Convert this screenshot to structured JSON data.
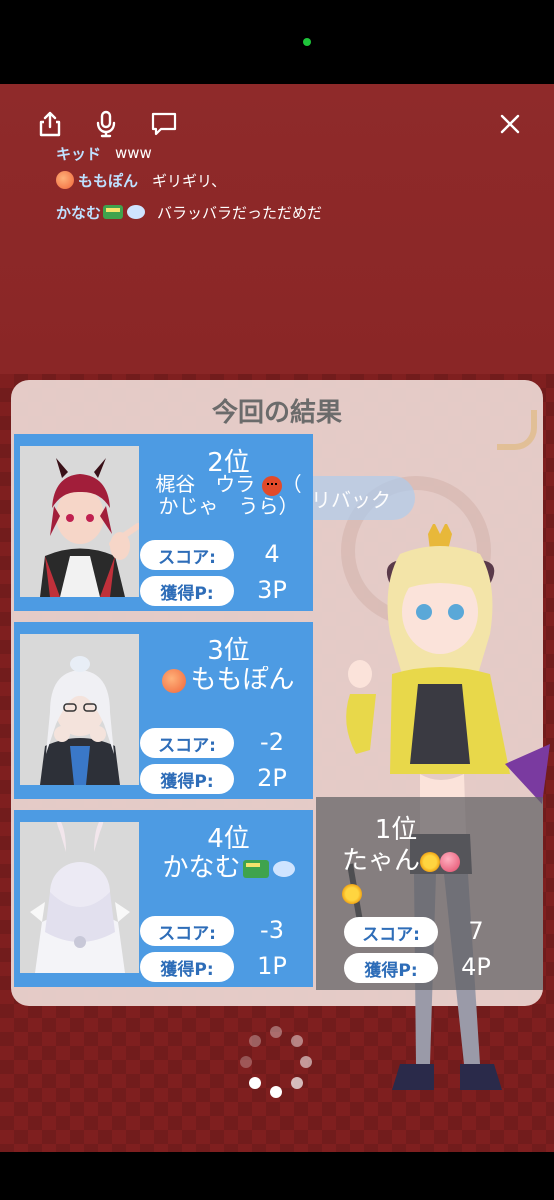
{
  "toolbar": {
    "share_icon": "share-icon",
    "mic_icon": "microphone-icon",
    "chat_icon": "chat-bubble-icon",
    "close_icon": "close-icon"
  },
  "chat": {
    "messages": [
      {
        "name": "キッド",
        "text": "www"
      },
      {
        "name": "ももぽん",
        "name_icon": "peach-emoji",
        "text": "ギリギリ、"
      },
      {
        "name": "かなむ",
        "name_icon": "tram-emoji",
        "text": "バラッバラだっただめだ"
      }
    ]
  },
  "results": {
    "title": "今回の結果",
    "feedback_label": "リバック",
    "score_label": "スコア:",
    "points_label": "獲得P:",
    "players": [
      {
        "rank": "2位",
        "name": "梶谷　ウラ",
        "name_reading": "かじゃ　うら",
        "score": "4",
        "points": "3P"
      },
      {
        "rank": "3位",
        "name": "ももぽん",
        "score": "-2",
        "points": "2P"
      },
      {
        "rank": "4位",
        "name": "かなむ",
        "score": "-3",
        "points": "1P"
      }
    ],
    "winner": {
      "rank": "1位",
      "name": "たゃん",
      "score": "7",
      "points": "4P"
    }
  },
  "colors": {
    "background_red": "#8e2626",
    "card_blue": "#4d9be3",
    "pill_text_blue": "#2e6db8",
    "panel_bg": "#eedad6",
    "title_gray": "#6b6b6b"
  }
}
